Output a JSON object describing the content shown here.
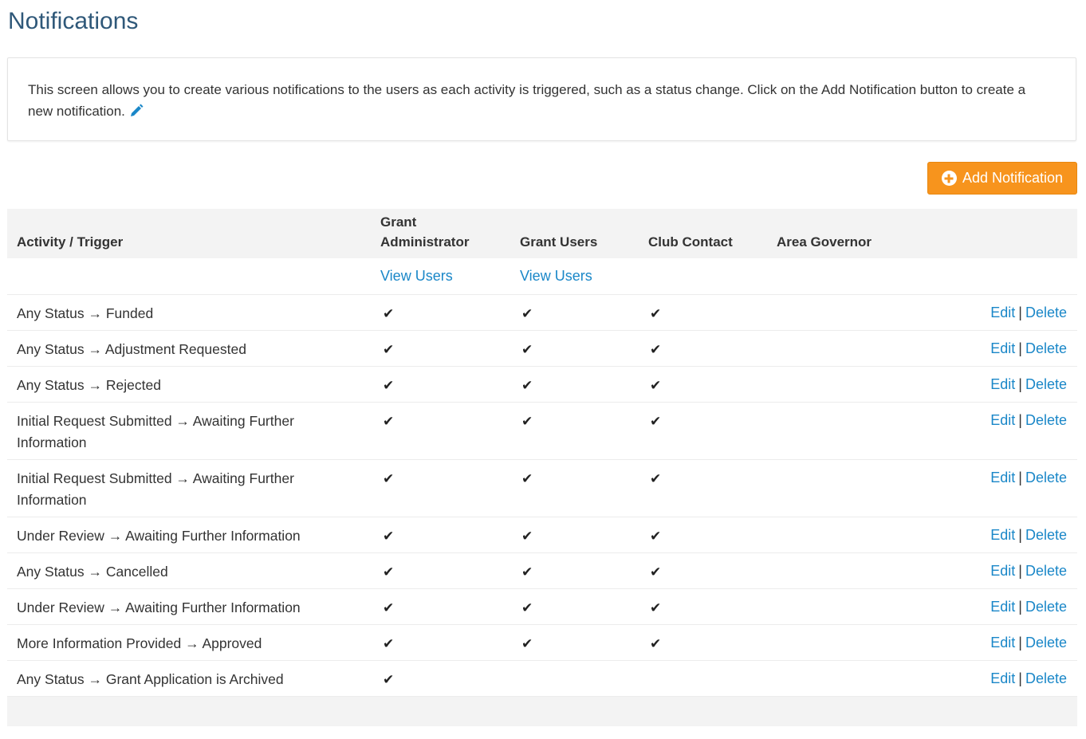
{
  "page": {
    "title": "Notifications"
  },
  "info": {
    "text": "This screen allows you to create various notifications to the users as each activity is triggered, such as a status change. Click on the Add Notification button to create a new notification."
  },
  "toolbar": {
    "add_label": "Add Notification"
  },
  "table": {
    "headers": {
      "activity": "Activity / Trigger",
      "grant_admin": "Grant Administrator",
      "grant_users": "Grant Users",
      "club_contact": "Club Contact",
      "area_governor": "Area Governor"
    },
    "view_users_label": "View Users",
    "edit_label": "Edit",
    "delete_label": "Delete",
    "separator": "|",
    "check_glyph": "✔",
    "rows": [
      {
        "trigger": "Any Status → Funded",
        "grant_admin": true,
        "grant_users": true,
        "club_contact": true,
        "area_governor": false
      },
      {
        "trigger": "Any Status → Adjustment Requested",
        "grant_admin": true,
        "grant_users": true,
        "club_contact": true,
        "area_governor": false
      },
      {
        "trigger": "Any Status → Rejected",
        "grant_admin": true,
        "grant_users": true,
        "club_contact": true,
        "area_governor": false
      },
      {
        "trigger": "Initial Request Submitted → Awaiting Further Information",
        "grant_admin": true,
        "grant_users": true,
        "club_contact": true,
        "area_governor": false
      },
      {
        "trigger": "Initial Request Submitted → Awaiting Further Information",
        "grant_admin": true,
        "grant_users": true,
        "club_contact": true,
        "area_governor": false
      },
      {
        "trigger": "Under Review → Awaiting Further Information",
        "grant_admin": true,
        "grant_users": true,
        "club_contact": true,
        "area_governor": false
      },
      {
        "trigger": "Any Status → Cancelled",
        "grant_admin": true,
        "grant_users": true,
        "club_contact": true,
        "area_governor": false
      },
      {
        "trigger": "Under Review → Awaiting Further Information",
        "grant_admin": true,
        "grant_users": true,
        "club_contact": true,
        "area_governor": false
      },
      {
        "trigger": "More Information Provided → Approved",
        "grant_admin": true,
        "grant_users": true,
        "club_contact": true,
        "area_governor": false
      },
      {
        "trigger": "Any Status → Grant Application is Archived",
        "grant_admin": true,
        "grant_users": false,
        "club_contact": false,
        "area_governor": false
      }
    ]
  },
  "colors": {
    "title": "#2f5879",
    "link": "#1a87c8",
    "accent": "#f7941d",
    "header_bg": "#f3f3f3"
  },
  "icons": {
    "info_edit": "pencil-icon",
    "add": "plus-circle-icon",
    "check": "check-icon"
  }
}
